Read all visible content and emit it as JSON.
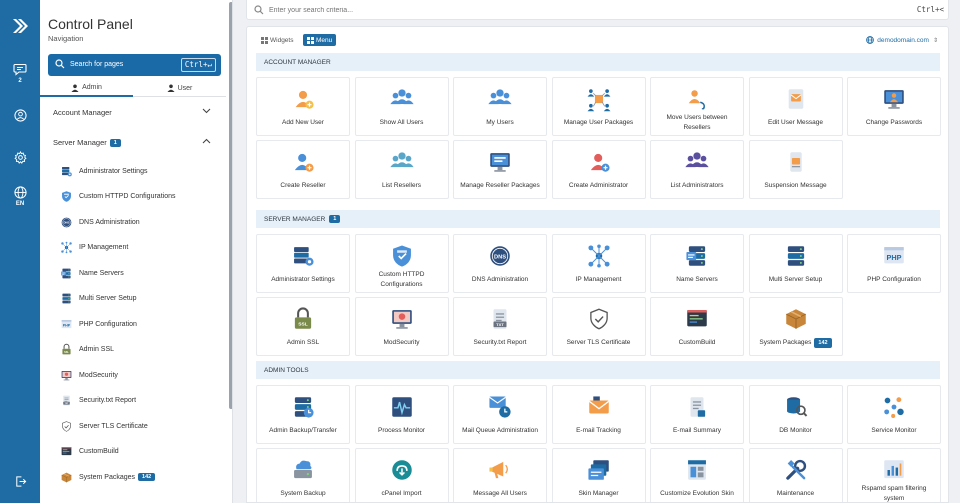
{
  "rail": {
    "messages_count": "2",
    "language": "EN"
  },
  "sidebar": {
    "title": "Control Panel",
    "subtitle": "Navigation",
    "search_label": "Search for pages",
    "search_shortcut": "Ctrl+↵",
    "tabs": [
      "Admin",
      "User"
    ],
    "account_manager": "Account Manager",
    "server_manager": "Server Manager",
    "server_manager_badge": "1",
    "items": [
      {
        "label": "Administrator Settings",
        "icon": "admin-settings-icon"
      },
      {
        "label": "Custom HTTPD Configurations",
        "icon": "httpd-shield-icon"
      },
      {
        "label": "DNS Administration",
        "icon": "dns-icon"
      },
      {
        "label": "IP Management",
        "icon": "ip-network-icon"
      },
      {
        "label": "Name Servers",
        "icon": "name-servers-icon"
      },
      {
        "label": "Multi Server Setup",
        "icon": "multi-server-icon"
      },
      {
        "label": "PHP Configuration",
        "icon": "php-icon"
      },
      {
        "label": "Admin SSL",
        "icon": "ssl-lock-icon"
      },
      {
        "label": "ModSecurity",
        "icon": "modsecurity-icon"
      },
      {
        "label": "Security.txt Report",
        "icon": "security-txt-icon"
      },
      {
        "label": "Server TLS Certificate",
        "icon": "tls-shield-icon"
      },
      {
        "label": "CustomBuild",
        "icon": "custombuild-icon"
      },
      {
        "label": "System Packages",
        "icon": "system-packages-icon",
        "badge": "142"
      }
    ]
  },
  "topsearch": {
    "placeholder": "Enter your search criteria...",
    "shortcut": "Ctrl+<"
  },
  "main": {
    "view_widgets": "Widgets",
    "view_menu": "Menu",
    "domain": "demodomain.com",
    "sections": [
      {
        "title": "ACCOUNT MANAGER",
        "badge": "",
        "tiles": [
          {
            "label": "Add New User",
            "icon": "add-user-icon"
          },
          {
            "label": "Show All Users",
            "icon": "users-group-icon"
          },
          {
            "label": "My Users",
            "icon": "my-users-icon"
          },
          {
            "label": "Manage User Packages",
            "icon": "user-packages-icon"
          },
          {
            "label": "Move Users between Resellers",
            "icon": "move-users-icon"
          },
          {
            "label": "Edit User Message",
            "icon": "edit-message-icon"
          },
          {
            "label": "Change Passwords",
            "icon": "change-password-icon"
          },
          {
            "label": "Create Reseller",
            "icon": "create-reseller-icon"
          },
          {
            "label": "List Resellers",
            "icon": "list-resellers-icon"
          },
          {
            "label": "Manage Reseller Packages",
            "icon": "reseller-packages-icon"
          },
          {
            "label": "Create Administrator",
            "icon": "create-admin-icon"
          },
          {
            "label": "List Administrators",
            "icon": "list-admins-icon"
          },
          {
            "label": "Suspension Message",
            "icon": "suspension-message-icon"
          }
        ]
      },
      {
        "title": "SERVER MANAGER",
        "badge": "1",
        "tiles": [
          {
            "label": "Administrator Settings",
            "icon": "admin-settings-icon"
          },
          {
            "label": "Custom HTTPD Configurations",
            "icon": "httpd-shield-icon"
          },
          {
            "label": "DNS Administration",
            "icon": "dns-icon"
          },
          {
            "label": "IP Management",
            "icon": "ip-network-icon"
          },
          {
            "label": "Name Servers",
            "icon": "name-servers-icon"
          },
          {
            "label": "Multi Server Setup",
            "icon": "multi-server-icon"
          },
          {
            "label": "PHP Configuration",
            "icon": "php-icon"
          },
          {
            "label": "Admin SSL",
            "icon": "ssl-lock-icon"
          },
          {
            "label": "ModSecurity",
            "icon": "modsecurity-icon"
          },
          {
            "label": "Security.txt Report",
            "icon": "security-txt-icon"
          },
          {
            "label": "Server TLS Certificate",
            "icon": "tls-shield-icon"
          },
          {
            "label": "CustomBuild",
            "icon": "custombuild-icon"
          },
          {
            "label": "System Packages",
            "icon": "system-packages-icon",
            "badge": "142"
          }
        ]
      },
      {
        "title": "ADMIN TOOLS",
        "badge": "",
        "tiles": [
          {
            "label": "Admin Backup/Transfer",
            "icon": "backup-transfer-icon"
          },
          {
            "label": "Process Monitor",
            "icon": "process-monitor-icon"
          },
          {
            "label": "Mail Queue Administration",
            "icon": "mail-queue-icon"
          },
          {
            "label": "E-mail Tracking",
            "icon": "email-tracking-icon"
          },
          {
            "label": "E-mail Summary",
            "icon": "email-summary-icon"
          },
          {
            "label": "DB Monitor",
            "icon": "db-monitor-icon"
          },
          {
            "label": "Service Monitor",
            "icon": "service-monitor-icon"
          },
          {
            "label": "System Backup",
            "icon": "system-backup-icon"
          },
          {
            "label": "cPanel Import",
            "icon": "cpanel-import-icon"
          },
          {
            "label": "Message All Users",
            "icon": "megaphone-icon"
          },
          {
            "label": "Skin Manager",
            "icon": "skin-manager-icon"
          },
          {
            "label": "Customize Evolution Skin",
            "icon": "customize-skin-icon"
          },
          {
            "label": "Maintenance",
            "icon": "maintenance-icon"
          },
          {
            "label": "Rspamd spam filtering system",
            "icon": "rspamd-icon"
          }
        ]
      }
    ]
  },
  "colors": {
    "rail": "#1f6ca5",
    "accent": "#1f6ca5",
    "section_header_bg": "#e5f0f9"
  }
}
